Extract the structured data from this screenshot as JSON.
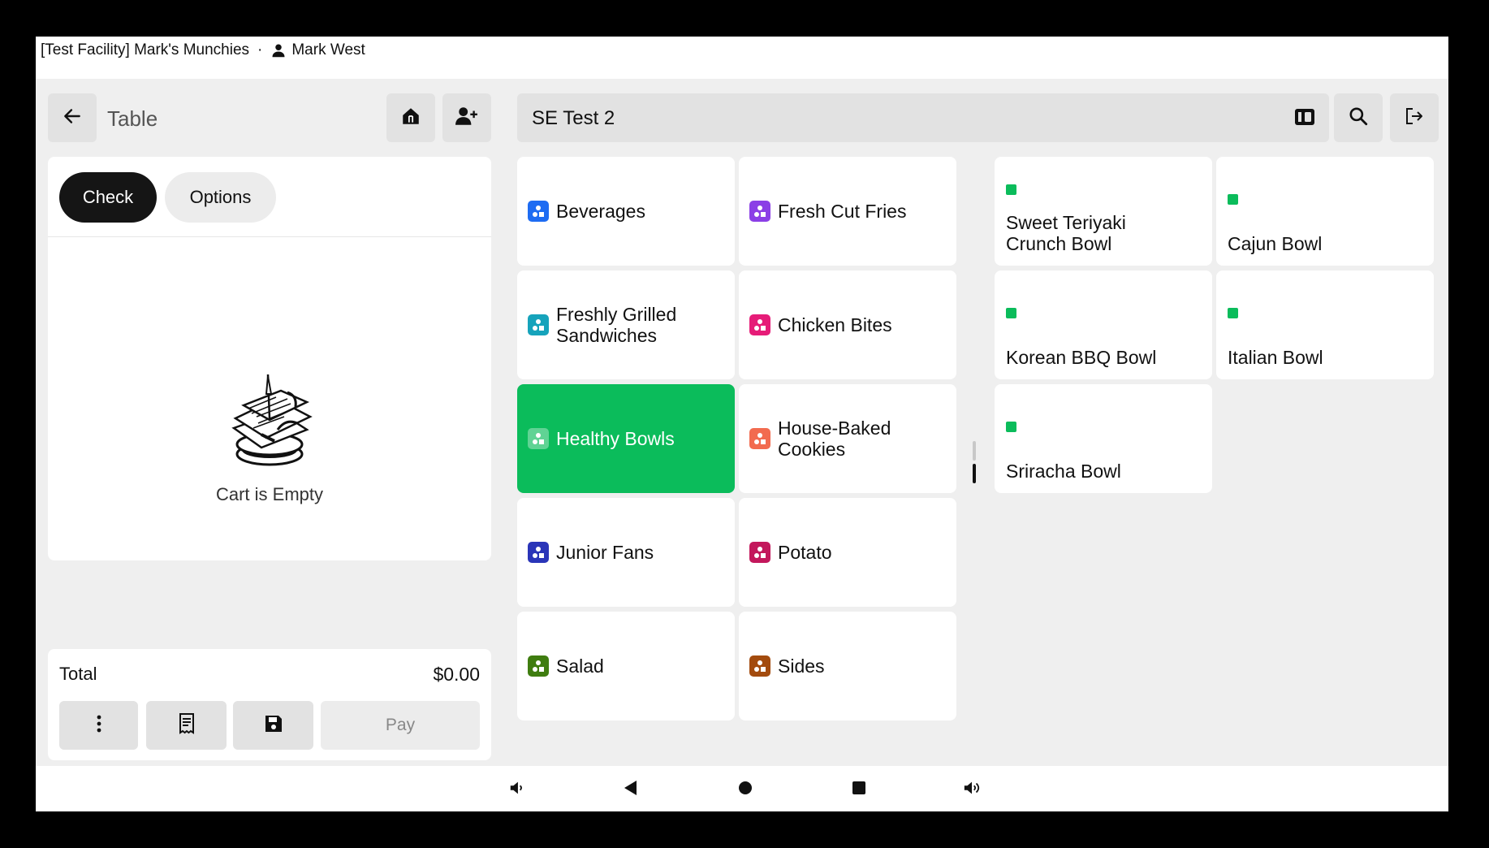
{
  "status_bar": {
    "facility": "[Test Facility] Mark's Munchies",
    "separator": "·",
    "user": "Mark West"
  },
  "left_panel": {
    "title": "Table",
    "tabs": [
      {
        "label": "Check",
        "active": true
      },
      {
        "label": "Options",
        "active": false
      }
    ],
    "empty_state": {
      "label": "Cart is Empty"
    },
    "total_label": "Total",
    "total_value": "$0.00",
    "pay_label": "Pay"
  },
  "menu": {
    "name": "SE Test 2",
    "categories": [
      {
        "label": "Beverages",
        "color": "#1e6cf2"
      },
      {
        "label": "Fresh Cut Fries",
        "color": "#8b3fe6"
      },
      {
        "label": "Freshly Grilled Sandwiches",
        "color": "#16a3bb"
      },
      {
        "label": "Chicken Bites",
        "color": "#e61c78"
      },
      {
        "label": "Healthy Bowls",
        "color": "#0bbc5b",
        "selected": true
      },
      {
        "label": "House-Baked Cookies",
        "color": "#f26b4f"
      },
      {
        "label": "Junior Fans",
        "color": "#2a35b8"
      },
      {
        "label": "Potato",
        "color": "#c3185c"
      },
      {
        "label": "Salad",
        "color": "#3f7d10"
      },
      {
        "label": "Sides",
        "color": "#a34b0e"
      }
    ],
    "items": [
      {
        "label": "Sweet Teriyaki Crunch Bowl"
      },
      {
        "label": "Cajun Bowl"
      },
      {
        "label": "Korean BBQ Bowl"
      },
      {
        "label": "Italian Bowl"
      },
      {
        "label": "Sriracha Bowl"
      }
    ]
  },
  "icons": {
    "back": "arrow-left-icon",
    "dine_in": "house-fork-icon",
    "add_guest": "person-plus-icon",
    "card_reader": "card-reader-icon",
    "search": "search-icon",
    "logout": "logout-icon",
    "more": "more-vertical-icon",
    "receipt": "receipt-icon",
    "save": "floppy-disk-icon"
  },
  "colors": {
    "selected_category": "#0bbc5b",
    "item_marker": "#0bbc5b",
    "active_tab": "#151515"
  }
}
